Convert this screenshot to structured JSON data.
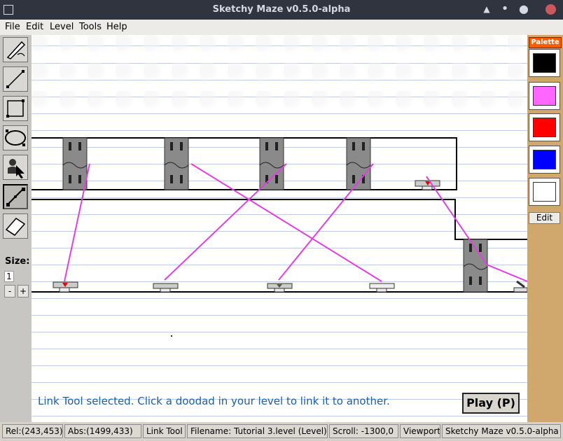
{
  "window": {
    "title": "Sketchy Maze v0.5.0-alpha",
    "minimize_glyph": "▲",
    "maximize_glyph": "•",
    "restore_glyph": "⬤"
  },
  "menu": [
    "File",
    "Edit",
    "Level",
    "Tools",
    "Help"
  ],
  "toolbar": {
    "tools": [
      {
        "name": "pencil-tool",
        "icon": "pencil-icon",
        "selected": false
      },
      {
        "name": "line-tool",
        "icon": "line-icon",
        "selected": false
      },
      {
        "name": "rectangle-tool",
        "icon": "rectangle-icon",
        "selected": false
      },
      {
        "name": "ellipse-tool",
        "icon": "ellipse-icon",
        "selected": false
      },
      {
        "name": "actor-tool",
        "icon": "actor-icon",
        "selected": false
      },
      {
        "name": "link-tool",
        "icon": "link-icon",
        "selected": true
      },
      {
        "name": "eraser-tool",
        "icon": "eraser-icon",
        "selected": false
      }
    ],
    "size_label": "Size:",
    "size_value": "1",
    "minus": "-",
    "plus": "+"
  },
  "canvas": {
    "message": "Link Tool selected. Click a doodad in your level to link it to another.",
    "play_button": "Play (P)",
    "link_color": "#e040e0"
  },
  "palette": {
    "title": "Palette",
    "swatches": [
      "#000000",
      "#ff66ff",
      "#ff0000",
      "#0000ff",
      "#ffffff"
    ],
    "edit_button": "Edit"
  },
  "status": {
    "rel": "Rel:(243,453)",
    "abs": "Abs:(1499,433)",
    "tool": "Link Tool",
    "filename": "Filename: Tutorial 3.level (Level)",
    "scroll": "Scroll: -1300,0",
    "viewport": "Viewport",
    "version": "Sketchy Maze v0.5.0-alpha"
  }
}
